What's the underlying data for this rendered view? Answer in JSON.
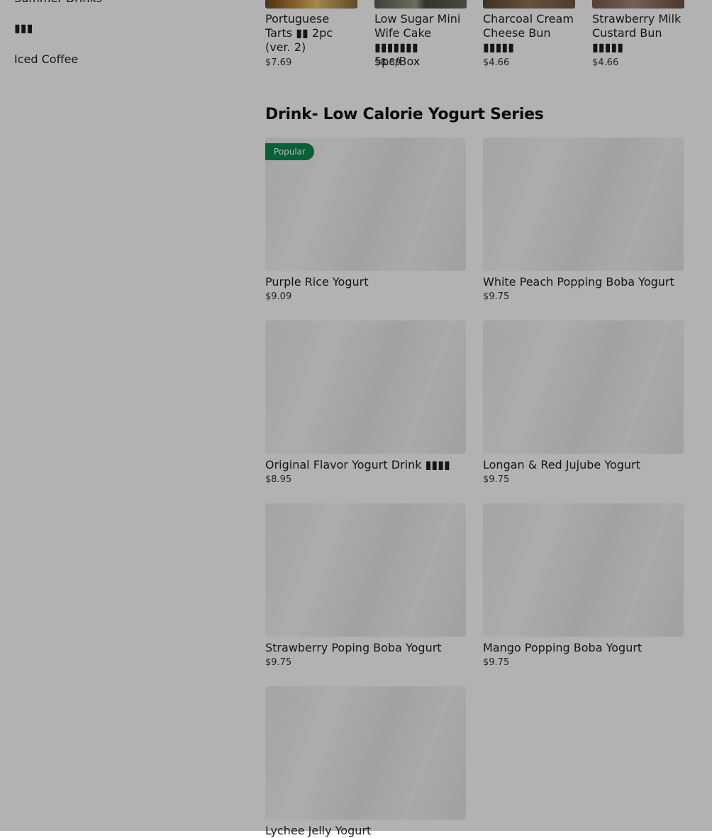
{
  "sidebar": {
    "items": [
      {
        "label": "Summer Drinks"
      },
      {
        "label": "▮▮▮"
      },
      {
        "label": "Iced Coffee"
      }
    ]
  },
  "top_items": [
    {
      "name": "Portuguese Tarts ▮▮ 2pc (ver. 2)",
      "price": "$7.69"
    },
    {
      "name": "Low Sugar Mini Wife Cake ▮▮▮▮▮▮▮ 5pc/Box",
      "price": "$8.89"
    },
    {
      "name": "Charcoal Cream Cheese Bun ▮▮▮▮▮",
      "price": "$4.66"
    },
    {
      "name": "Strawberry Milk Custard Bun ▮▮▮▮▮",
      "price": "$4.66"
    }
  ],
  "section": {
    "title": "Drink- Low Calorie Yogurt Series",
    "items": [
      {
        "name": "Purple Rice Yogurt",
        "price": "$9.09",
        "badge": "Popular"
      },
      {
        "name": "White Peach Popping Boba Yogurt",
        "price": "$9.75"
      },
      {
        "name": "Original Flavor Yogurt Drink ▮▮▮▮",
        "price": "$8.95"
      },
      {
        "name": "Longan & Red Jujube Yogurt",
        "price": "$9.75"
      },
      {
        "name": "Strawberry Poping Boba Yogurt",
        "price": "$9.75"
      },
      {
        "name": "Mango Popping Boba Yogurt",
        "price": "$9.75"
      },
      {
        "name": "Lychee Jelly Yogurt",
        "price": ""
      }
    ]
  }
}
